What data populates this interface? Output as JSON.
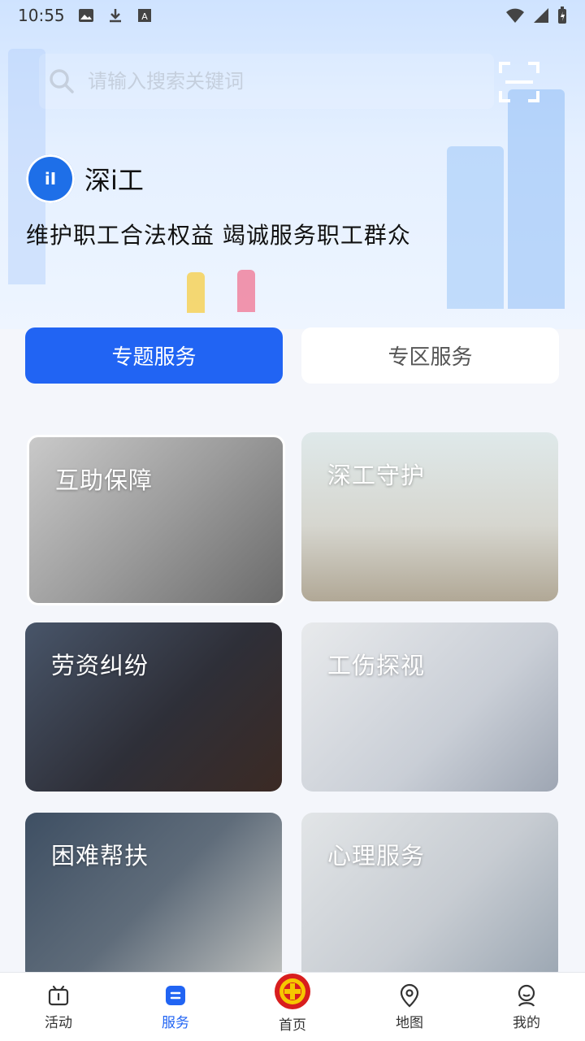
{
  "status_bar": {
    "time": "10:55"
  },
  "search": {
    "placeholder": "请输入搜索关键词"
  },
  "brand": {
    "name": "深i工",
    "logo_text": "iI",
    "slogan": "维护职工合法权益  竭诚服务职工群众"
  },
  "tabs": [
    {
      "label": "专题服务",
      "active": true
    },
    {
      "label": "专区服务",
      "active": false
    }
  ],
  "services": [
    {
      "label": "互助保障"
    },
    {
      "label": "深工守护"
    },
    {
      "label": "劳资纠纷"
    },
    {
      "label": "工伤探视"
    },
    {
      "label": "困难帮扶"
    },
    {
      "label": "心理服务"
    }
  ],
  "bottom_nav": [
    {
      "label": "活动",
      "icon": "activity-icon",
      "active": false
    },
    {
      "label": "服务",
      "icon": "service-icon",
      "active": true
    },
    {
      "label": "首页",
      "icon": "union-logo-icon",
      "active": false
    },
    {
      "label": "地图",
      "icon": "location-pin-icon",
      "active": false
    },
    {
      "label": "我的",
      "icon": "user-icon",
      "active": false
    }
  ],
  "colors": {
    "primary": "#2164f3",
    "banner": "#d6e7ff"
  }
}
